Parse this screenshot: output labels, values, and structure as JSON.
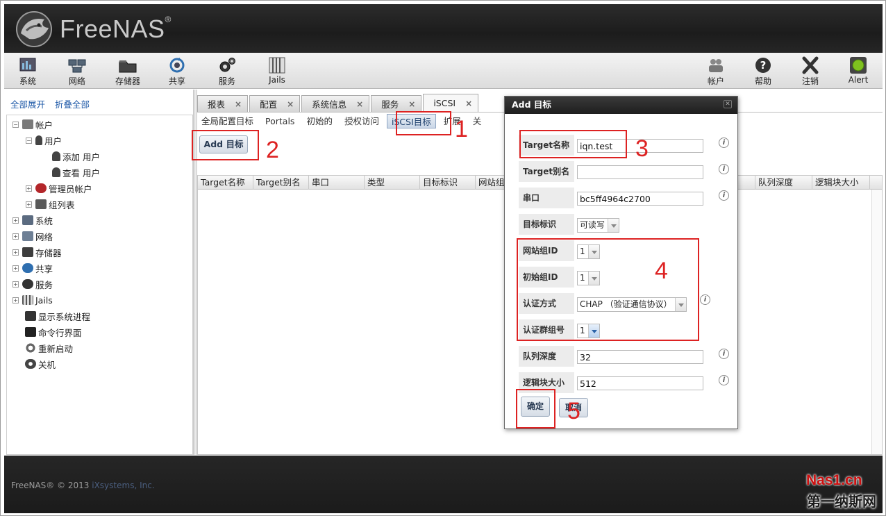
{
  "header": {
    "logo_text": "FreeNAS",
    "logo_reg": "®"
  },
  "toolbar": {
    "left": [
      {
        "label": "系统",
        "icon": "system-icon"
      },
      {
        "label": "网络",
        "icon": "network-icon"
      },
      {
        "label": "存储器",
        "icon": "storage-icon"
      },
      {
        "label": "共享",
        "icon": "sharing-icon"
      },
      {
        "label": "服务",
        "icon": "services-icon"
      },
      {
        "label": "Jails",
        "icon": "jails-icon"
      }
    ],
    "right": [
      {
        "label": "帐户",
        "icon": "account-icon"
      },
      {
        "label": "帮助",
        "icon": "help-icon"
      },
      {
        "label": "注销",
        "icon": "logout-icon"
      },
      {
        "label": "Alert",
        "icon": "alert-icon"
      }
    ]
  },
  "nav": {
    "expand_all": "全部展开",
    "collapse_all": "折叠全部",
    "tree": [
      {
        "label": "帐户",
        "toggle": "−"
      },
      {
        "label": "用户",
        "toggle": "−"
      },
      {
        "label": "添加 用户",
        "toggle": ""
      },
      {
        "label": "查看 用户",
        "toggle": ""
      },
      {
        "label": "管理员帐户",
        "toggle": "+"
      },
      {
        "label": "组列表",
        "toggle": "+"
      },
      {
        "label": "系统",
        "toggle": "+"
      },
      {
        "label": "网络",
        "toggle": "+"
      },
      {
        "label": "存储器",
        "toggle": "+"
      },
      {
        "label": "共享",
        "toggle": "+"
      },
      {
        "label": "服务",
        "toggle": "+"
      },
      {
        "label": "Jails",
        "toggle": "+"
      },
      {
        "label": "显示系统进程",
        "toggle": ""
      },
      {
        "label": "命令行界面",
        "toggle": ""
      },
      {
        "label": "重新启动",
        "toggle": ""
      },
      {
        "label": "关机",
        "toggle": ""
      }
    ]
  },
  "tabs": [
    {
      "label": "报表",
      "close": "×"
    },
    {
      "label": "配置",
      "close": "×"
    },
    {
      "label": "系统信息",
      "close": "×"
    },
    {
      "label": "服务",
      "close": "×"
    },
    {
      "label": "iSCSI",
      "close": "×"
    }
  ],
  "subtabs": [
    "全局配置目标",
    "Portals",
    "初始的",
    "授权访问",
    "iSCSI目标",
    "扩展",
    "关"
  ],
  "add_button": "Add 目标",
  "grid": {
    "columns": [
      "Target名称",
      "Target别名",
      "串口",
      "类型",
      "目标标识",
      "网站组",
      "队列深度",
      "逻辑块大小"
    ]
  },
  "dialog": {
    "title": "Add 目标",
    "fields": [
      {
        "label": "Target名称",
        "value": "iqn.test",
        "type": "input"
      },
      {
        "label": "Target别名",
        "value": "",
        "type": "input"
      },
      {
        "label": "串口",
        "value": "bc5ff4964c2700",
        "type": "input"
      },
      {
        "label": "目标标识",
        "value": "可读写",
        "type": "select"
      },
      {
        "label": "网站组ID",
        "value": "1",
        "type": "select"
      },
      {
        "label": "初始组ID",
        "value": "1",
        "type": "select"
      },
      {
        "label": "认证方式",
        "value": "CHAP （验证通信协议）",
        "type": "select"
      },
      {
        "label": "认证群组号",
        "value": "1",
        "type": "select"
      },
      {
        "label": "队列深度",
        "value": "32",
        "type": "input"
      },
      {
        "label": "逻辑块大小",
        "value": "512",
        "type": "input"
      }
    ],
    "ok": "确定",
    "cancel": "取消"
  },
  "annotations": [
    "1",
    "2",
    "3",
    "4",
    "5"
  ],
  "footer": {
    "copyright": "FreeNAS® © 2013 ",
    "company": "iXsystems, Inc."
  },
  "watermark": {
    "line1": "Nas1.cn",
    "line2": "第一纳斯网"
  },
  "colors": {
    "annotation": "#dd2222",
    "link": "#1f5aa8",
    "header_bg": "#222222"
  }
}
